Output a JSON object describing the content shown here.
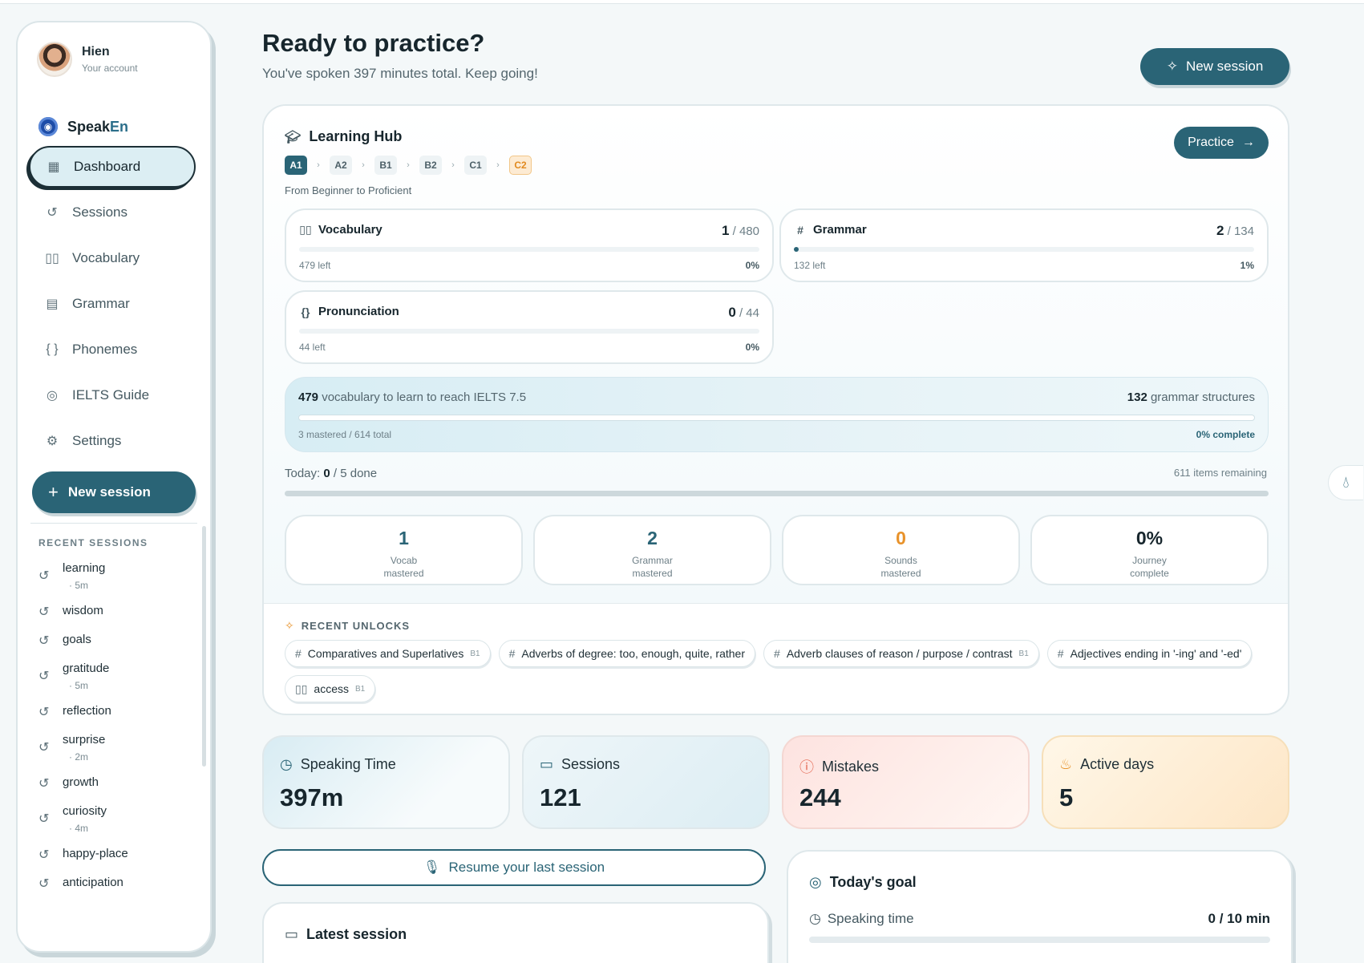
{
  "user": {
    "name": "Hien",
    "subtitle": "Your account"
  },
  "brand": {
    "speak": "Speak",
    "en": "En"
  },
  "nav": [
    {
      "label": "Dashboard",
      "icon": "dashboard-icon",
      "active": true
    },
    {
      "label": "Sessions",
      "icon": "history-icon"
    },
    {
      "label": "Vocabulary",
      "icon": "book-icon"
    },
    {
      "label": "Grammar",
      "icon": "bookmark-book-icon"
    },
    {
      "label": "Phonemes",
      "icon": "braces-icon"
    },
    {
      "label": "IELTS Guide",
      "icon": "target-icon"
    },
    {
      "label": "Settings",
      "icon": "gear-icon"
    }
  ],
  "sidebar_new_session": "New session",
  "recent_sessions_label": "RECENT SESSIONS",
  "recent_sessions": [
    {
      "title": "learning",
      "meta": "· 5m"
    },
    {
      "title": "wisdom",
      "meta": ""
    },
    {
      "title": "goals",
      "meta": ""
    },
    {
      "title": "gratitude",
      "meta": "· 5m"
    },
    {
      "title": "reflection",
      "meta": ""
    },
    {
      "title": "surprise",
      "meta": "· 2m"
    },
    {
      "title": "growth",
      "meta": ""
    },
    {
      "title": "curiosity",
      "meta": "· 4m"
    },
    {
      "title": "happy-place",
      "meta": ""
    },
    {
      "title": "anticipation",
      "meta": ""
    }
  ],
  "header": {
    "title": "Ready to practice?",
    "subtitle": "You've spoken 397 minutes total. Keep going!",
    "new_session": "New session"
  },
  "hub": {
    "title": "Learning Hub",
    "practice": "Practice",
    "levels": [
      "A1",
      "A2",
      "B1",
      "B2",
      "C1",
      "C2"
    ],
    "note": "From Beginner to Proficient",
    "categories": [
      {
        "name": "Vocabulary",
        "icon": "book-icon",
        "done": "1",
        "total": "/ 480",
        "left": "479 left",
        "pct": "0%",
        "fraction": 0
      },
      {
        "name": "Grammar",
        "icon": "hash-icon",
        "done": "2",
        "total": "/ 134",
        "left": "132 left",
        "pct": "1%",
        "fraction": 0.01
      },
      {
        "name": "Pronunciation",
        "icon": "braces-icon",
        "done": "0",
        "total": "/ 44",
        "left": "44 left",
        "pct": "0%",
        "fraction": 0
      }
    ],
    "ielts": {
      "vocab_count": "479",
      "vocab_text": "vocabulary to learn to reach IELTS 7.5",
      "grammar_count": "132",
      "grammar_text": "grammar structures",
      "mastered": "3 mastered / 614 total",
      "complete": "0% complete"
    },
    "today": {
      "prefix": "Today:",
      "done": "0",
      "suffix": "/ 5 done",
      "remaining": "611 items remaining"
    },
    "stats": [
      {
        "value": "1",
        "label": "Vocab mastered",
        "color": "teal"
      },
      {
        "value": "2",
        "label": "Grammar mastered",
        "color": "teal"
      },
      {
        "value": "0",
        "label": "Sounds mastered",
        "color": "orange"
      },
      {
        "value": "0%",
        "label": "Journey complete",
        "color": "dark"
      }
    ],
    "unlocks_label": "RECENT UNLOCKS",
    "unlocks": [
      {
        "icon": "hash-icon",
        "text": "Comparatives and Superlatives",
        "level": "B1"
      },
      {
        "icon": "hash-icon",
        "text": "Adverbs of degree: too, enough, quite, rather",
        "level": ""
      },
      {
        "icon": "hash-icon",
        "text": "Adverb clauses of reason / purpose / contrast",
        "level": "B1"
      },
      {
        "icon": "hash-icon",
        "text": "Adjectives ending in '-ing' and '-ed'",
        "level": ""
      },
      {
        "icon": "book-icon",
        "text": "access",
        "level": "B1"
      }
    ]
  },
  "metrics": [
    {
      "label": "Speaking Time",
      "value": "397m",
      "icon": "clock-icon"
    },
    {
      "label": "Sessions",
      "value": "121",
      "icon": "chat-icon"
    },
    {
      "label": "Mistakes",
      "value": "244",
      "icon": "alert-icon"
    },
    {
      "label": "Active days",
      "value": "5",
      "icon": "flame-icon"
    }
  ],
  "resume": "Resume your last session",
  "latest": {
    "title": "Latest session"
  },
  "goal": {
    "title": "Today's goal",
    "row_label": "Speaking time",
    "row_value": "0 / 10 min"
  }
}
